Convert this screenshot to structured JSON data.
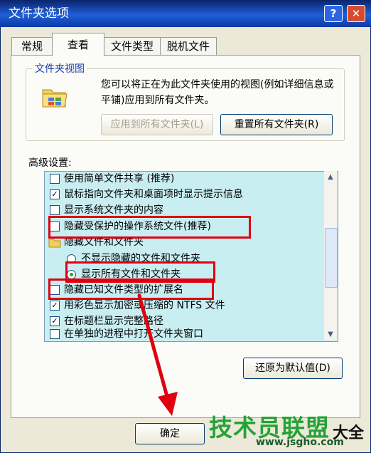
{
  "window": {
    "title": "文件夹选项",
    "help": "?",
    "close": "✕"
  },
  "tabs": [
    {
      "label": "常规"
    },
    {
      "label": "查看"
    },
    {
      "label": "文件类型"
    },
    {
      "label": "脱机文件"
    }
  ],
  "folder_views": {
    "group_label": "文件夹视图",
    "description": "您可以将正在为此文件夹使用的视图(例如详细信息或平铺)应用到所有文件夹。",
    "apply_all_label": "应用到所有文件夹(L)",
    "reset_all_label": "重置所有文件夹(R)"
  },
  "advanced": {
    "label": "高级设置:",
    "items": [
      {
        "kind": "checkbox",
        "checked": false,
        "text": "使用简单文件共享 (推荐)"
      },
      {
        "kind": "checkbox",
        "checked": true,
        "text": "鼠标指向文件夹和桌面项时显示提示信息"
      },
      {
        "kind": "checkbox",
        "checked": false,
        "text": "显示系统文件夹的内容"
      },
      {
        "kind": "checkbox",
        "checked": false,
        "text": "隐藏受保护的操作系统文件(推荐)"
      },
      {
        "kind": "folder",
        "text": "隐藏文件和文件夹"
      },
      {
        "kind": "radio",
        "checked": false,
        "text": "不显示隐藏的文件和文件夹"
      },
      {
        "kind": "radio",
        "checked": true,
        "text": "显示所有文件和文件夹"
      },
      {
        "kind": "checkbox",
        "checked": false,
        "text": "隐藏已知文件类型的扩展名"
      },
      {
        "kind": "checkbox",
        "checked": true,
        "text": "用彩色显示加密或压缩的 NTFS 文件"
      },
      {
        "kind": "checkbox",
        "checked": true,
        "text": "在标题栏显示完整路径"
      },
      {
        "kind": "checkbox",
        "checked": false,
        "text": "在单独的进程中打开文件夹窗口"
      }
    ],
    "restore_defaults_label": "还原为默认值(D)"
  },
  "footer": {
    "ok_label": "确定"
  },
  "watermark": {
    "title": "技术员联盟",
    "url": "www.jsgho.com",
    "suffix": "大全"
  },
  "colors": {
    "highlight": "#e00010",
    "list_bg": "#c9eef2",
    "watermark": "#25a238"
  }
}
